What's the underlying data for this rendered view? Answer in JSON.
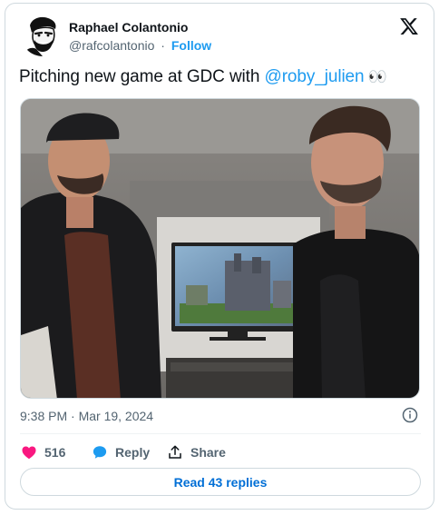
{
  "author": {
    "name": "Raphael Colantonio",
    "handle": "@rafcolantonio",
    "separator": "·",
    "follow_label": "Follow"
  },
  "brand_icon": "x-logo-icon",
  "tweet": {
    "text_before": "Pitching new game at GDC with ",
    "mention": "@roby_julien",
    "emoji": "👀"
  },
  "photo": {
    "alt": "Two men standing in front of a TV showing a game at GDC"
  },
  "meta": {
    "timestamp": "9:38 PM · Mar 19, 2024",
    "info_icon": "info-icon"
  },
  "actions": {
    "likes": "516",
    "reply_label": "Reply",
    "share_label": "Share"
  },
  "read_replies_label": "Read 43 replies",
  "colors": {
    "accent": "#1d9bf0",
    "like": "#f91880",
    "text": "#0f1419",
    "muted": "#536471",
    "border": "#cfd9de"
  }
}
